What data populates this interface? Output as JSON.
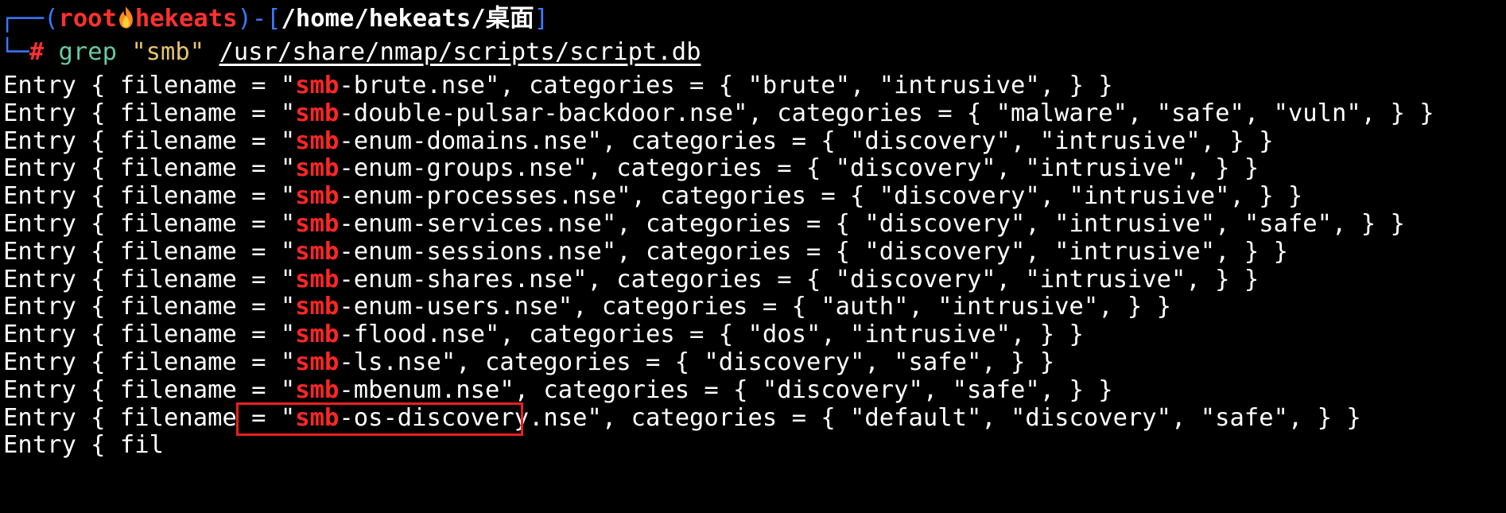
{
  "prompt": {
    "frame_top": "┌──(",
    "user": "root",
    "fire_icon": "fire-icon",
    "host": "hekeats",
    "frame_mid": ")-[",
    "cwd": "/home/hekeats/桌面",
    "frame_end": "]",
    "frame_bottom": "└─",
    "hash": "#",
    "command": "grep",
    "pattern": "\"smb\"",
    "file_path": "/usr/share/nmap/scripts/script.db"
  },
  "output": {
    "match_text": "smb",
    "lines": [
      {
        "before": "Entry { filename = \"",
        "after": "-brute.nse\", categories = { \"brute\", \"intrusive\", } }"
      },
      {
        "before": "Entry { filename = \"",
        "after": "-double-pulsar-backdoor.nse\", categories = { \"malware\", \"safe\", \"vuln\", } }"
      },
      {
        "before": "Entry { filename = \"",
        "after": "-enum-domains.nse\", categories = { \"discovery\", \"intrusive\", } }"
      },
      {
        "before": "Entry { filename = \"",
        "after": "-enum-groups.nse\", categories = { \"discovery\", \"intrusive\", } }"
      },
      {
        "before": "Entry { filename = \"",
        "after": "-enum-processes.nse\", categories = { \"discovery\", \"intrusive\", } }"
      },
      {
        "before": "Entry { filename = \"",
        "after": "-enum-services.nse\", categories = { \"discovery\", \"intrusive\", \"safe\", } }"
      },
      {
        "before": "Entry { filename = \"",
        "after": "-enum-sessions.nse\", categories = { \"discovery\", \"intrusive\", } }"
      },
      {
        "before": "Entry { filename = \"",
        "after": "-enum-shares.nse\", categories = { \"discovery\", \"intrusive\", } }"
      },
      {
        "before": "Entry { filename = \"",
        "after": "-enum-users.nse\", categories = { \"auth\", \"intrusive\", } }"
      },
      {
        "before": "Entry { filename = \"",
        "after": "-flood.nse\", categories = { \"dos\", \"intrusive\", } }"
      },
      {
        "before": "Entry { filename = \"",
        "after": "-ls.nse\", categories = { \"discovery\", \"safe\", } }"
      },
      {
        "before": "Entry { filename = \"",
        "after": "-mbenum.nse\", categories = { \"discovery\", \"safe\", } }"
      },
      {
        "before": "Entry { filename = \"",
        "after": "-os-discovery.nse\", categories = { \"default\", \"discovery\", \"safe\", } }",
        "highlighted": true
      },
      {
        "before": "Entry { fil",
        "after": "",
        "partial": true
      }
    ]
  },
  "colors": {
    "background": "#000000",
    "frame": "#3b78ff",
    "user_host": "#ff3030",
    "command": "#67c9a0",
    "string": "#e8c46a",
    "match": "#ff2626",
    "highlight_border": "#e82020"
  }
}
